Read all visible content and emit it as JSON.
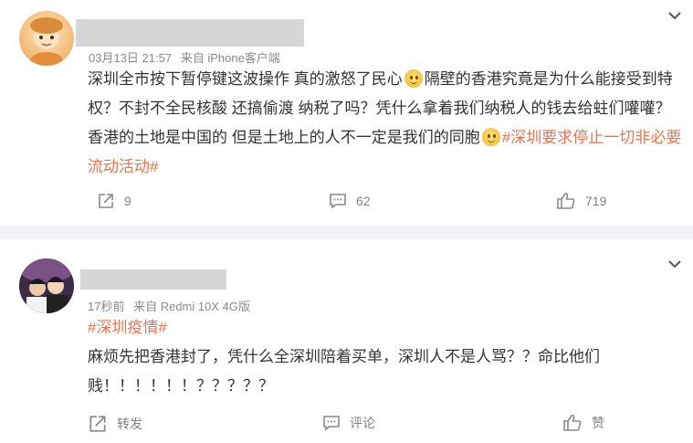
{
  "posts": [
    {
      "time": "03月13日 21:57",
      "source": "来自 iPhone客户端",
      "text_1": "深圳全市按下暂停键这波操作 真的激怒了民心",
      "text_2": "隔壁的香港究竟是为什么能接受到特权？不封不全民核酸 还搞偷渡 纳税了吗？凭什么拿着我们纳税人的钱去给蛀们嚾嚾？香港的土地是中国的 但是土地上的人不一定是我们的同胞",
      "topic": "#深圳要求停止一切非必要流动活动#",
      "share_count": "9",
      "comment_count": "62",
      "like_count": "719"
    },
    {
      "time": "17秒前",
      "source": "来自 Redmi 10X 4G版",
      "topic": "#深圳疫情#",
      "text": "麻烦先把香港封了，凭什么全深圳陪着买单，深圳人不是人骂？？命比他们贱！！！！！！？？？？？",
      "share_label": "转发",
      "comment_label": "评论",
      "like_label": "赞"
    }
  ],
  "icons": {
    "share": "share-icon",
    "comment": "comment-icon",
    "like": "thumbs-up-icon",
    "more": "chevron-down-icon",
    "emoji": "smile-emoji-icon"
  },
  "colors": {
    "topic": "#eb7350",
    "meta": "#8a8a8a",
    "separator": "#f2f2f5"
  }
}
